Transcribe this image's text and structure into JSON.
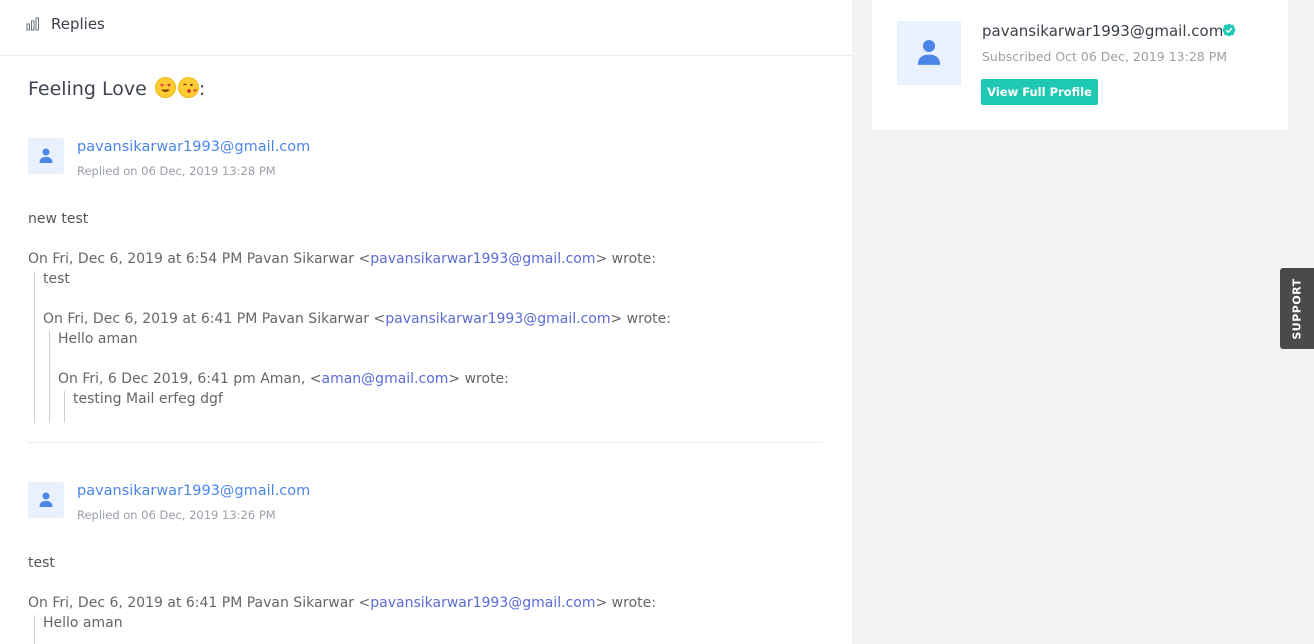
{
  "header": {
    "title": "Replies",
    "icon": "bar-chart-icon"
  },
  "subject": {
    "text": "Feeling Love",
    "suffix": ":"
  },
  "replies": [
    {
      "sender": "pavansikarwar1993@gmail.com",
      "meta": "Replied on 06 Dec, 2019 13:28 PM",
      "body": "new test",
      "quotes": [
        {
          "pre": "On Fri, Dec 6, 2019 at 6:54 PM Pavan Sikarwar <",
          "link": "pavansikarwar1993@gmail.com",
          "post": "> wrote:"
        },
        {
          "text": "test"
        },
        {
          "pre": "On Fri, Dec 6, 2019 at 6:41 PM Pavan Sikarwar <",
          "link": "pavansikarwar1993@gmail.com",
          "post": "> wrote:"
        },
        {
          "text": "Hello aman"
        },
        {
          "pre": "On Fri, 6 Dec 2019, 6:41 pm Aman, <",
          "link": "aman@gmail.com",
          "post": "> wrote:"
        },
        {
          "text": "testing Mail erfeg dgf"
        }
      ]
    },
    {
      "sender": "pavansikarwar1993@gmail.com",
      "meta": "Replied on 06 Dec, 2019 13:26 PM",
      "body": "test",
      "quotes": [
        {
          "pre": "On Fri, Dec 6, 2019 at 6:41 PM Pavan Sikarwar <",
          "link": "pavansikarwar1993@gmail.com",
          "post": "> wrote:"
        },
        {
          "text": "Hello aman"
        }
      ]
    }
  ],
  "profile": {
    "email": "pavansikarwar1993@gmail.com",
    "subscribed": "Subscribed Oct 06 Dec, 2019 13:28 PM",
    "button": "View Full Profile"
  },
  "support": {
    "label": "SUPPORT"
  },
  "colors": {
    "accent": "#1fc8b2",
    "link": "#4a86e8",
    "avatar_bg": "#e8f1fd"
  }
}
